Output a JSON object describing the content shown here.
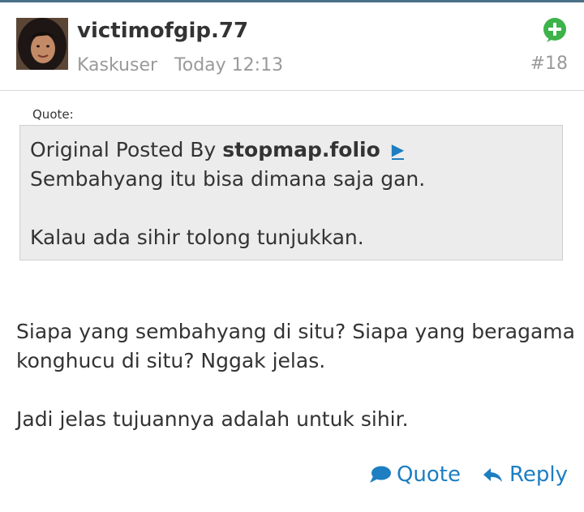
{
  "post": {
    "author": "victimofgip.77",
    "rank": "Kaskuser",
    "time": "Today 12:13",
    "number": "#18",
    "icons": {
      "add": "plus-circle-icon",
      "goto": "arrow-right-icon",
      "quote": "speech-bubble-icon",
      "reply": "reply-arrow-icon"
    },
    "colors": {
      "accent": "#1d7ec2",
      "add_icon": "#3db34a",
      "quote_bg": "#ececec",
      "top_line": "#4a6f86"
    }
  },
  "quote": {
    "label": "Quote:",
    "prefix": "Original Posted By",
    "author": "stopmap.folio",
    "lines": [
      "Sembahyang itu bisa dimana saja gan.",
      "",
      "Kalau ada sihir tolong tunjukkan."
    ]
  },
  "body": {
    "lines": [
      "Siapa yang sembahyang di situ? Siapa yang beragama",
      "konghucu di situ? Nggak jelas.",
      "",
      "Jadi jelas tujuannya adalah untuk sihir."
    ]
  },
  "actions": {
    "quote_label": "Quote",
    "reply_label": "Reply"
  }
}
